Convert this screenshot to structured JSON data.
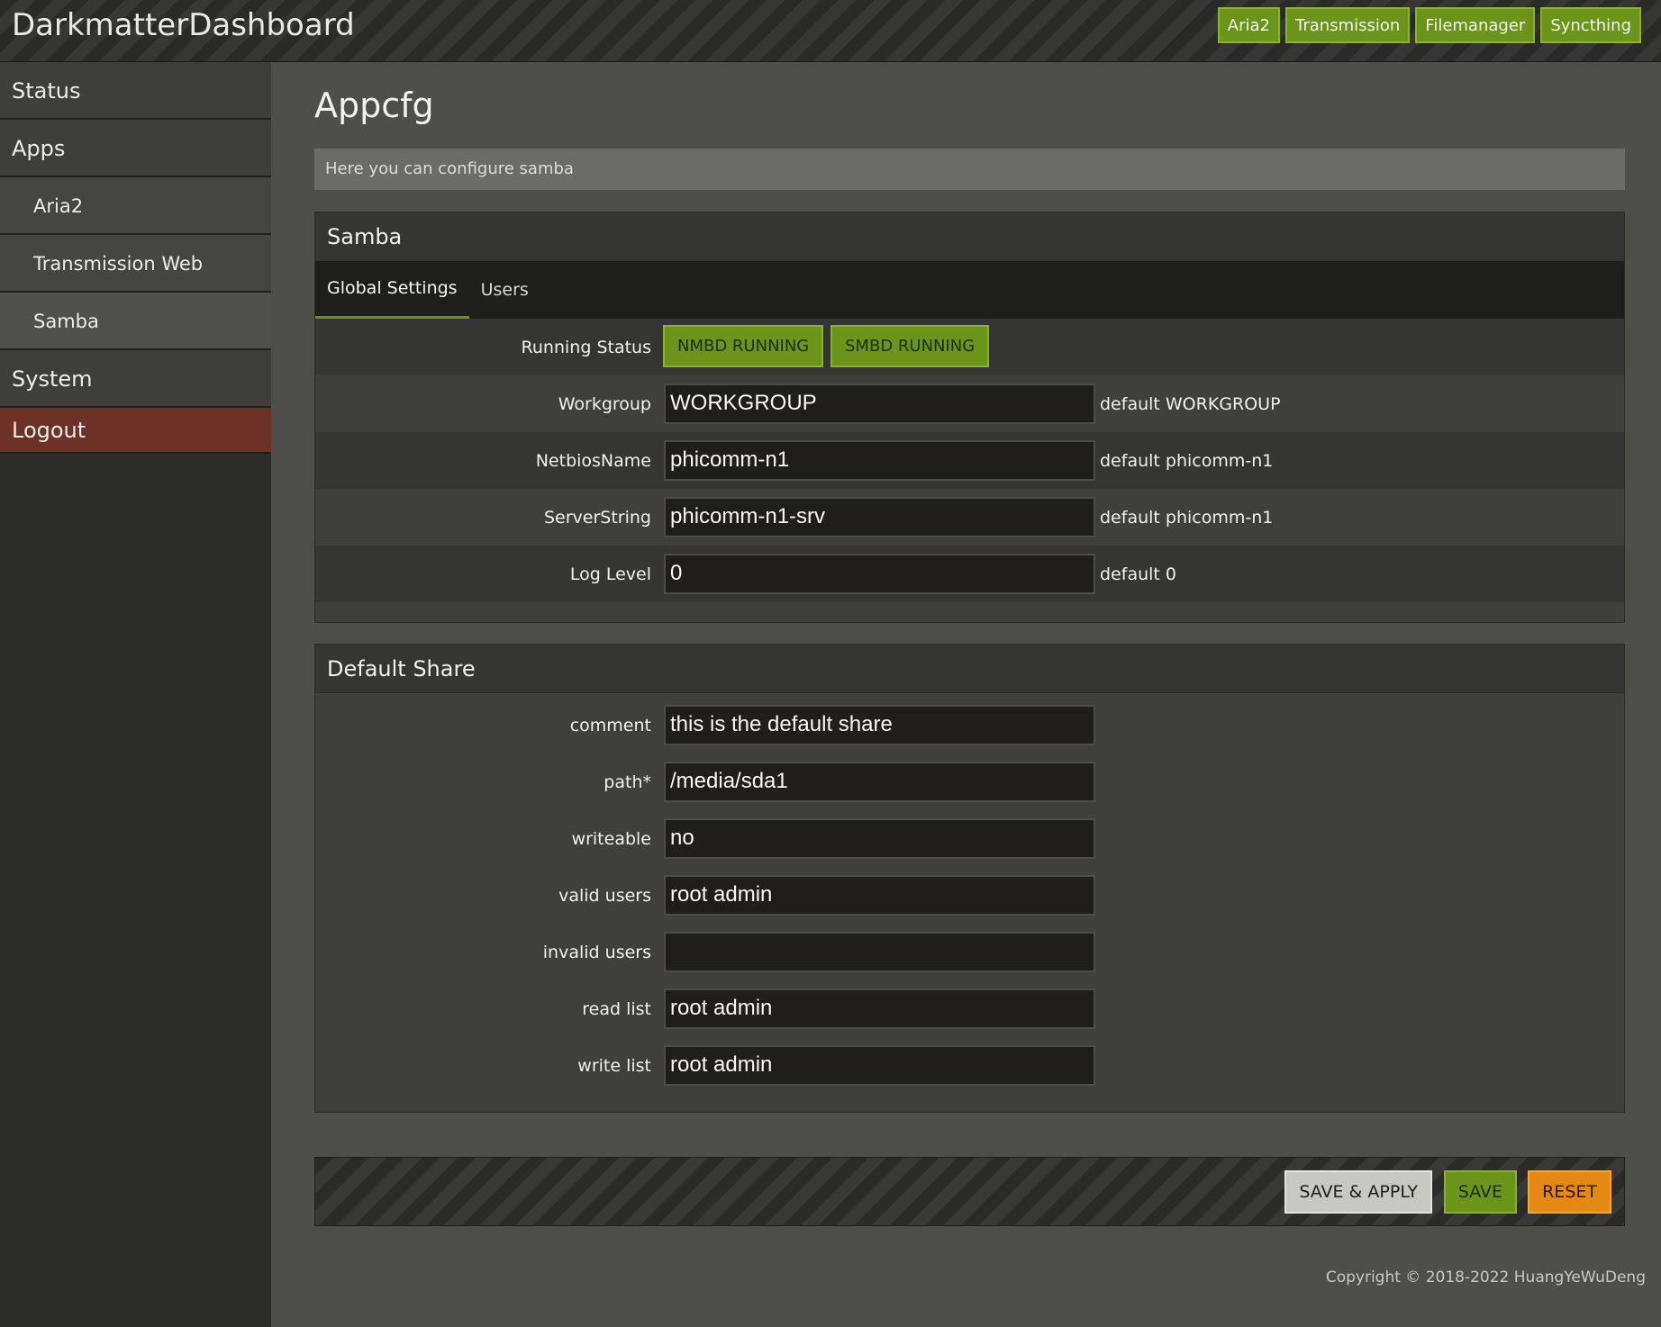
{
  "header": {
    "brand": "DarkmatterDashboard",
    "links": [
      "Aria2",
      "Transmission",
      "Filemanager",
      "Syncthing"
    ]
  },
  "sidebar": {
    "status": "Status",
    "apps": "Apps",
    "aria2": "Aria2",
    "transmission": "Transmission Web",
    "samba": "Samba",
    "system": "System",
    "logout": "Logout"
  },
  "page": {
    "title": "Appcfg",
    "description": "Here you can configure samba"
  },
  "samba": {
    "title": "Samba",
    "tabs": [
      "Global Settings",
      "Users"
    ],
    "running_status_label": "Running Status",
    "nmbd": "NMBD RUNNING",
    "smbd": "SMBD RUNNING",
    "workgroup": {
      "label": "Workgroup",
      "value": "WORKGROUP",
      "hint": "default WORKGROUP"
    },
    "netbios": {
      "label": "NetbiosName",
      "value": "phicomm-n1",
      "hint": "default phicomm-n1"
    },
    "server": {
      "label": "ServerString",
      "value": "phicomm-n1-srv",
      "hint": "default phicomm-n1"
    },
    "loglevel": {
      "label": "Log Level",
      "value": "0",
      "hint": "default 0"
    }
  },
  "share": {
    "title": "Default Share",
    "comment": {
      "label": "comment",
      "value": "this is the default share"
    },
    "path": {
      "label": "path*",
      "value": "/media/sda1"
    },
    "writeable": {
      "label": "writeable",
      "value": "no"
    },
    "valid_users": {
      "label": "valid users",
      "value": "root admin"
    },
    "invalid_users": {
      "label": "invalid users",
      "value": ""
    },
    "read_list": {
      "label": "read list",
      "value": "root admin"
    },
    "write_list": {
      "label": "write list",
      "value": "root admin"
    }
  },
  "actions": {
    "save_apply": "SAVE & APPLY",
    "save": "SAVE",
    "reset": "RESET"
  },
  "footer": {
    "copyright": "Copyright © 2018-2022 HuangYeWuDeng"
  },
  "colors": {
    "accent_green": "#6a9518",
    "reset_orange": "#e48a12",
    "logout_red": "#6d3128"
  }
}
